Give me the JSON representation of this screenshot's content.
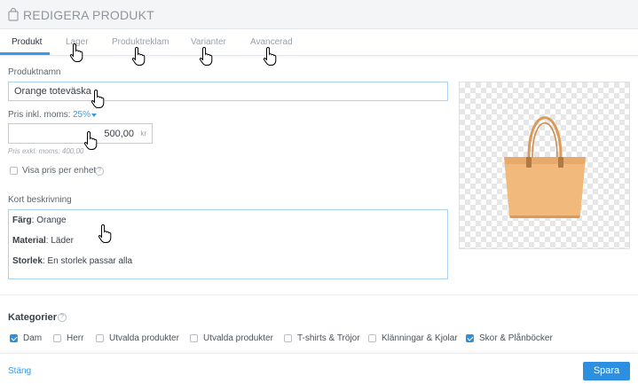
{
  "header": {
    "title": "REDIGERA PRODUKT",
    "icon": "shopping-bag-icon"
  },
  "tabs": [
    {
      "label": "Produkt",
      "active": true
    },
    {
      "label": "Lager",
      "active": false
    },
    {
      "label": "Produktreklam",
      "active": false
    },
    {
      "label": "Varianter",
      "active": false
    },
    {
      "label": "Avancerad",
      "active": false
    }
  ],
  "form": {
    "name_label": "Produktnamn",
    "name_value": "Orange toteväska",
    "price_label": "Pris inkl. moms:",
    "tax_rate": "25%",
    "price_value": "500,00",
    "price_unit": "kr",
    "price_excl": "Pris exkl. moms: 400,00",
    "show_unit_price_label": "Visa pris per enhet",
    "show_unit_price_checked": false,
    "short_desc_label": "Kort beskrivning",
    "desc_lines": [
      {
        "key": "Färg",
        "value": ": Orange"
      },
      {
        "key": "Material",
        "value": ": Läder"
      },
      {
        "key": "Storlek",
        "value": ": En storlek passar alla"
      }
    ]
  },
  "image": {
    "alt": "orange tote bag",
    "color": "#f2b97d"
  },
  "categories": {
    "title": "Kategorier",
    "items": [
      {
        "label": "Dam",
        "checked": true
      },
      {
        "label": "Herr",
        "checked": false
      },
      {
        "label": "Utvalda produkter",
        "checked": false
      },
      {
        "label": "Utvalda produkter",
        "checked": false
      },
      {
        "label": "T-shirts & Tröjor",
        "checked": false
      },
      {
        "label": "Klänningar & Kjolar",
        "checked": false
      },
      {
        "label": "Skor & Plånböcker",
        "checked": true
      }
    ]
  },
  "footer": {
    "close_label": "Stäng",
    "save_label": "Spara"
  },
  "colors": {
    "accent": "#2d8fe0",
    "link": "#3a99e6"
  }
}
